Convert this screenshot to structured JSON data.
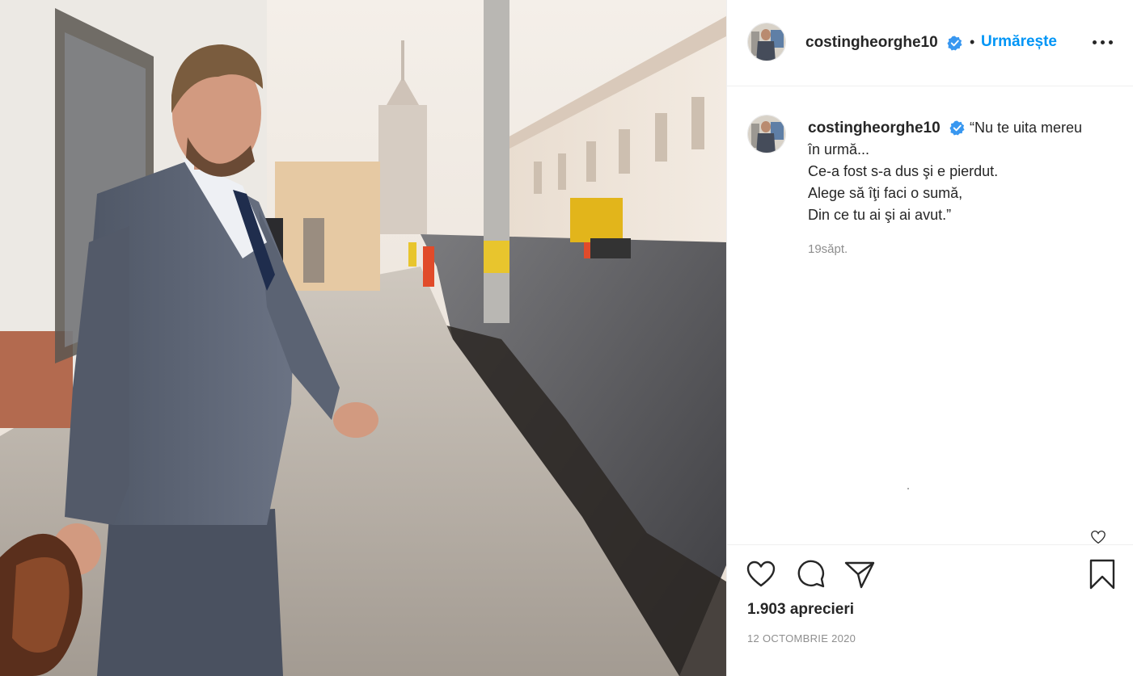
{
  "post": {
    "author": {
      "username": "costingheorghe10",
      "verified": true,
      "verified_icon": "verified-badge-icon",
      "follow_label": "Urmărește",
      "separator": "•"
    },
    "caption": {
      "lines": [
        "“Nu te uita mereu",
        "în urmă...",
        "Ce-a fost s-a dus şi e pierdut.",
        "Alege să îţi faci o sumă,",
        "Din ce tu ai şi ai avut.”"
      ],
      "age": "19săpt."
    },
    "likes": "1.903 aprecieri",
    "date": "12 OCTOMBRIE 2020",
    "actions": [
      "heart-icon",
      "comment-icon",
      "share-icon",
      "bookmark-icon"
    ]
  },
  "colors": {
    "accent": "#0095f6",
    "verified": "#3897f0",
    "text": "#262626",
    "muted": "#8e8e8e",
    "divider": "#efefef"
  }
}
